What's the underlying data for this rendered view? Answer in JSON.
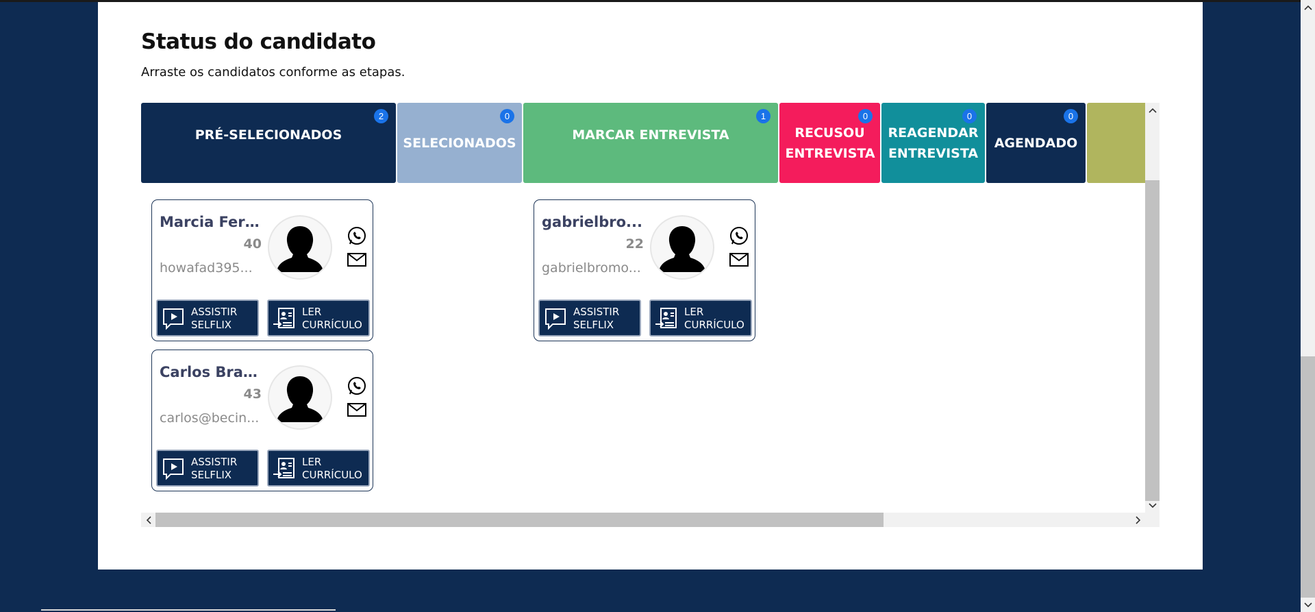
{
  "page": {
    "title": "Status do candidato",
    "subtitle": "Arraste os candidatos conforme as etapas."
  },
  "columns": [
    {
      "label": "PRÉ-SELECIONADOS",
      "count": "2",
      "color": "#0e2b52"
    },
    {
      "label": "SELECIONADOS",
      "count": "0",
      "color": "#96b0d0"
    },
    {
      "label": "MARCAR ENTREVISTA",
      "count": "1",
      "color": "#5dba7d"
    },
    {
      "label": "RECUSOU ENTREVISTA",
      "count": "0",
      "color": "#f41c5c"
    },
    {
      "label": "REAGENDAR ENTREVISTA",
      "count": "0",
      "color": "#118f9b"
    },
    {
      "label": "AGENDADO",
      "count": "0",
      "color": "#0e2b52"
    },
    {
      "label": "",
      "count": "",
      "color": "#b0b55e"
    }
  ],
  "cards": [
    {
      "name": "Marcia Ferri...",
      "age": "40",
      "email": "howafad395...",
      "column": "PRÉ-SELECIONADOS"
    },
    {
      "name": "Carlos Bran...",
      "age": "43",
      "email": "carlos@becin...",
      "column": "PRÉ-SELECIONADOS"
    },
    {
      "name": "gabrielbro...",
      "age": "22",
      "email": "gabrielbromo...",
      "column": "MARCAR ENTREVISTA"
    }
  ],
  "buttons": {
    "watch_selfix": "ASSISTIR\nSELFLIX",
    "read_resume": "LER\nCURRÍCULO"
  },
  "icons": {
    "whatsapp": "whatsapp-icon",
    "email": "mail-icon",
    "video": "play-video-icon",
    "resume": "resume-icon",
    "avatar": "user-silhouette-icon"
  },
  "colors": {
    "background": "#0e2b52",
    "badge": "#1a73e8",
    "card_name": "#3b4262"
  }
}
